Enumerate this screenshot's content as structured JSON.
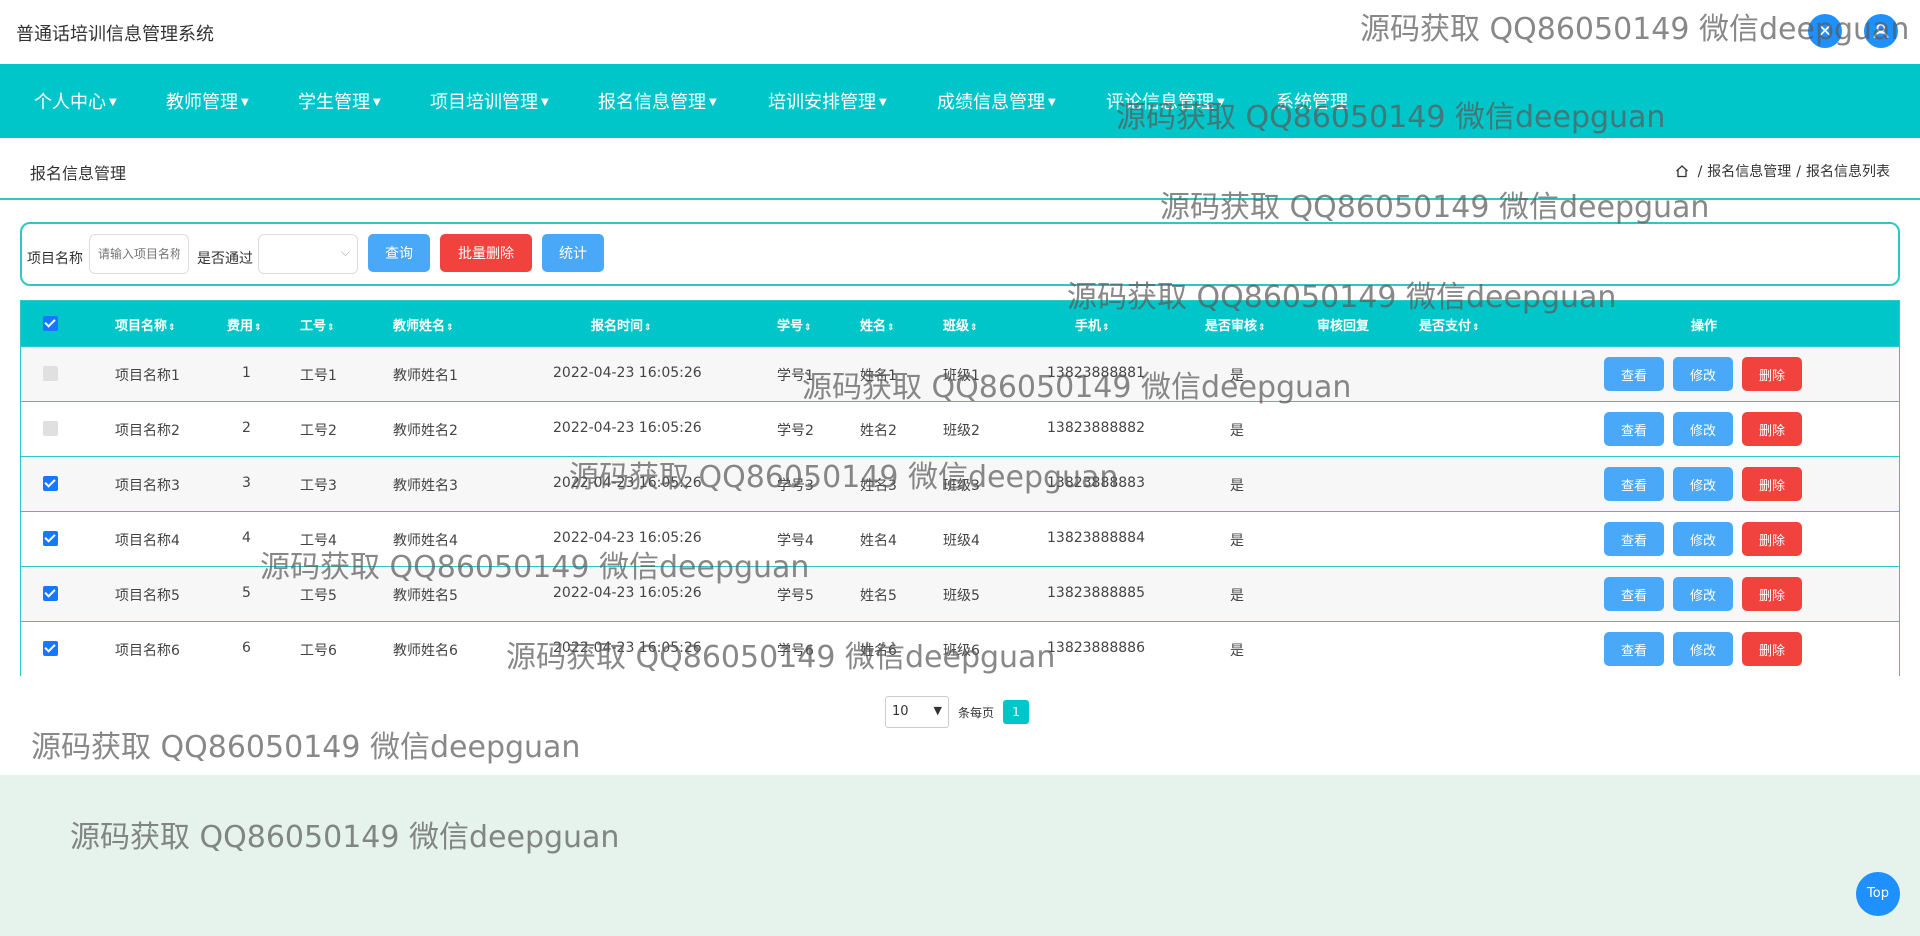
{
  "app_title": "普通话培训信息管理系统",
  "top_icons": [
    "close-icon",
    "user-icon"
  ],
  "nav": [
    {
      "label": "个人中心"
    },
    {
      "label": "教师管理"
    },
    {
      "label": "学生管理"
    },
    {
      "label": "项目培训管理"
    },
    {
      "label": "报名信息管理"
    },
    {
      "label": "培训安排管理"
    },
    {
      "label": "成绩信息管理"
    },
    {
      "label": "评论信息管理"
    },
    {
      "label": "系统管理"
    }
  ],
  "page_heading": "报名信息管理",
  "breadcrumb": [
    "报名信息管理",
    "报名信息列表"
  ],
  "search": {
    "project_label": "项目名称",
    "project_placeholder": "请输入项目名称",
    "pass_label": "是否通过",
    "pass_value": "",
    "query_btn": "查询",
    "batch_delete_btn": "批量删除",
    "stats_btn": "统计"
  },
  "table": {
    "headers": [
      "项目名称",
      "费用",
      "工号",
      "教师姓名",
      "报名时间",
      "学号",
      "姓名",
      "班级",
      "手机",
      "是否审核",
      "审核回复",
      "是否支付",
      "操作"
    ],
    "rows": [
      {
        "checked": false,
        "project": "项目名称1",
        "fee": "1",
        "job_no": "工号1",
        "teacher": "教师姓名1",
        "time": "2022-04-23 16:05:26",
        "student_no": "学号1",
        "name": "姓名1",
        "class": "班级1",
        "phone": "13823888881",
        "reviewed": "是",
        "reply": "",
        "paid": ""
      },
      {
        "checked": false,
        "project": "项目名称2",
        "fee": "2",
        "job_no": "工号2",
        "teacher": "教师姓名2",
        "time": "2022-04-23 16:05:26",
        "student_no": "学号2",
        "name": "姓名2",
        "class": "班级2",
        "phone": "13823888882",
        "reviewed": "是",
        "reply": "",
        "paid": ""
      },
      {
        "checked": true,
        "project": "项目名称3",
        "fee": "3",
        "job_no": "工号3",
        "teacher": "教师姓名3",
        "time": "2022-04-23 16:05:26",
        "student_no": "学号3",
        "name": "姓名3",
        "class": "班级3",
        "phone": "13823888883",
        "reviewed": "是",
        "reply": "",
        "paid": ""
      },
      {
        "checked": true,
        "project": "项目名称4",
        "fee": "4",
        "job_no": "工号4",
        "teacher": "教师姓名4",
        "time": "2022-04-23 16:05:26",
        "student_no": "学号4",
        "name": "姓名4",
        "class": "班级4",
        "phone": "13823888884",
        "reviewed": "是",
        "reply": "",
        "paid": ""
      },
      {
        "checked": true,
        "project": "项目名称5",
        "fee": "5",
        "job_no": "工号5",
        "teacher": "教师姓名5",
        "time": "2022-04-23 16:05:26",
        "student_no": "学号5",
        "name": "姓名5",
        "class": "班级5",
        "phone": "13823888885",
        "reviewed": "是",
        "reply": "",
        "paid": ""
      },
      {
        "checked": true,
        "project": "项目名称6",
        "fee": "6",
        "job_no": "工号6",
        "teacher": "教师姓名6",
        "time": "2022-04-23 16:05:26",
        "student_no": "学号6",
        "name": "姓名6",
        "class": "班级6",
        "phone": "13823888886",
        "reviewed": "是",
        "reply": "",
        "paid": ""
      }
    ],
    "actions": {
      "view": "查看",
      "edit": "修改",
      "delete": "删除"
    }
  },
  "pager": {
    "page_size": "10",
    "per_page_label": "条每页",
    "current_page": "1"
  },
  "top_button": "Top",
  "watermark": "源码获取 QQ86050149 微信deepguan",
  "colors": {
    "primary": "#00c6c9",
    "button_blue": "#4aa8f8",
    "button_red": "#f2423d",
    "footer": "#e6f3ed"
  }
}
